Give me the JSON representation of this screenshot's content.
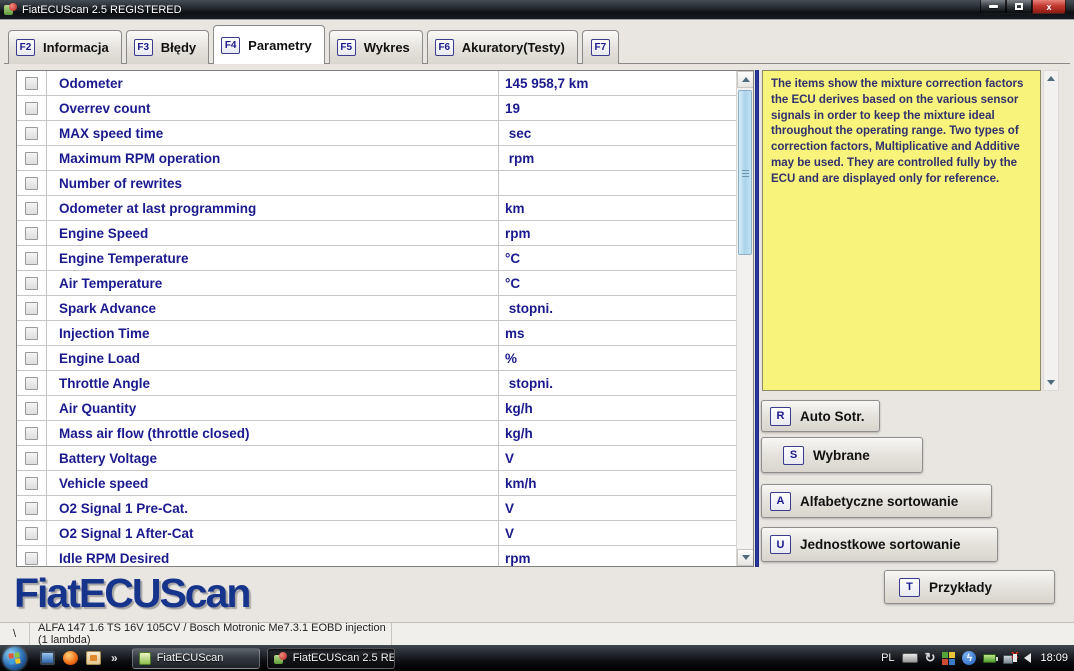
{
  "window": {
    "title": "FiatECUScan 2.5 REGISTERED"
  },
  "tabs": [
    {
      "key": "F2",
      "label": "Informacja"
    },
    {
      "key": "F3",
      "label": "Błędy"
    },
    {
      "key": "F4",
      "label": "Parametry"
    },
    {
      "key": "F5",
      "label": "Wykres"
    },
    {
      "key": "F6",
      "label": "Akuratory(Testy)"
    },
    {
      "key": "F7",
      "label": ""
    }
  ],
  "parameters": {
    "rows": [
      {
        "name": "Odometer",
        "value": "145 958,7 km"
      },
      {
        "name": "Overrev count",
        "value": "19"
      },
      {
        "name": "MAX speed time",
        "value": " sec"
      },
      {
        "name": "Maximum RPM operation",
        "value": " rpm"
      },
      {
        "name": "Number of rewrites",
        "value": ""
      },
      {
        "name": "Odometer at last programming",
        "value": "km"
      },
      {
        "name": "Engine Speed",
        "value": "rpm"
      },
      {
        "name": "Engine Temperature",
        "value": "°C"
      },
      {
        "name": "Air Temperature",
        "value": "°C"
      },
      {
        "name": "Spark Advance",
        "value": " stopni."
      },
      {
        "name": "Injection Time",
        "value": "ms"
      },
      {
        "name": "Engine Load",
        "value": "%"
      },
      {
        "name": "Throttle Angle",
        "value": " stopni."
      },
      {
        "name": "Air Quantity",
        "value": "kg/h"
      },
      {
        "name": "Mass air flow (throttle closed)",
        "value": "kg/h"
      },
      {
        "name": "Battery Voltage",
        "value": "V"
      },
      {
        "name": "Vehicle speed",
        "value": "km/h"
      },
      {
        "name": "O2 Signal 1 Pre-Cat.",
        "value": "V"
      },
      {
        "name": "O2 Signal 1 After-Cat",
        "value": "V"
      },
      {
        "name": "Idle RPM Desired",
        "value": "rpm"
      }
    ]
  },
  "info_box": {
    "text": "The items show the mixture correction factors the ECU derives based on the various sensor signals in order to keep the mixture ideal throughout the operating range. Two types of correction factors, Multiplicative and Additive may be used. They are controlled fully by the ECU and are displayed only for reference."
  },
  "action_buttons": [
    {
      "key": "R",
      "label": "Auto Sotr."
    },
    {
      "key": "S",
      "label": "Wybrane"
    },
    {
      "key": "A",
      "label": "Alfabetyczne sortowanie"
    },
    {
      "key": "U",
      "label": "Jednostkowe sortowanie"
    },
    {
      "key": "T",
      "label": "Przykłady"
    }
  ],
  "logo": "FiatECUScan",
  "status_bar": {
    "left": "\\",
    "vehicle": "ALFA 147 1.6 TS 16V 105CV / Bosch Motronic Me7.3.1 EOBD injection (1 lambda)"
  },
  "taskbar": {
    "overflow_chevron": "»",
    "buttons": [
      {
        "label": "FiatECUScan"
      },
      {
        "label": "FiatECUScan 2.5 RE..."
      }
    ],
    "tray": {
      "language": "PL",
      "time": "18:09"
    }
  },
  "colors": {
    "param_text": "#1a1a8f",
    "info_bg": "#f8f37a",
    "separator_navy": "#1b2a8c",
    "close_button_red": "#c33a30",
    "scroll_thumb_blue": "#a9d3ea"
  }
}
